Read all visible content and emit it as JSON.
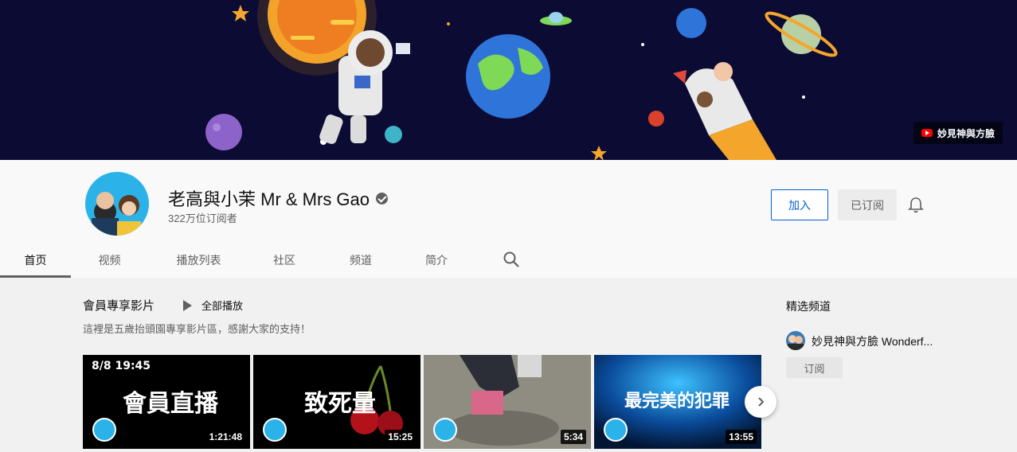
{
  "banner": {
    "badge_text": "妙見神與方臉"
  },
  "channel": {
    "name": "老高與小茉 Mr & Mrs Gao",
    "subscribers": "322万位订阅者",
    "join_label": "加入",
    "subscribed_label": "已订阅"
  },
  "tabs": [
    "首页",
    "视频",
    "播放列表",
    "社区",
    "频道",
    "简介"
  ],
  "shelf": {
    "title": "會員專享影片",
    "play_all": "全部播放",
    "description": "這裡是五歲抬頭園專享影片區，感謝大家的支持！",
    "videos": [
      {
        "overlay_top": "8/8 19:45",
        "overlay_main": "會員直播",
        "duration": "1:21:48"
      },
      {
        "overlay_main": "致死量",
        "duration": "15:25"
      },
      {
        "overlay_main": "",
        "duration": "5:34"
      },
      {
        "overlay_main": "最完美的犯罪",
        "duration": "13:55"
      }
    ]
  },
  "featured": {
    "title": "精选频道",
    "channel_name": "妙見神與方臉 Wonderf...",
    "subscribe_label": "订阅"
  },
  "colors": {
    "accent_blue": "#065fd4",
    "banner_bg": "#0b0b33",
    "youtube_red": "#ff0000"
  }
}
